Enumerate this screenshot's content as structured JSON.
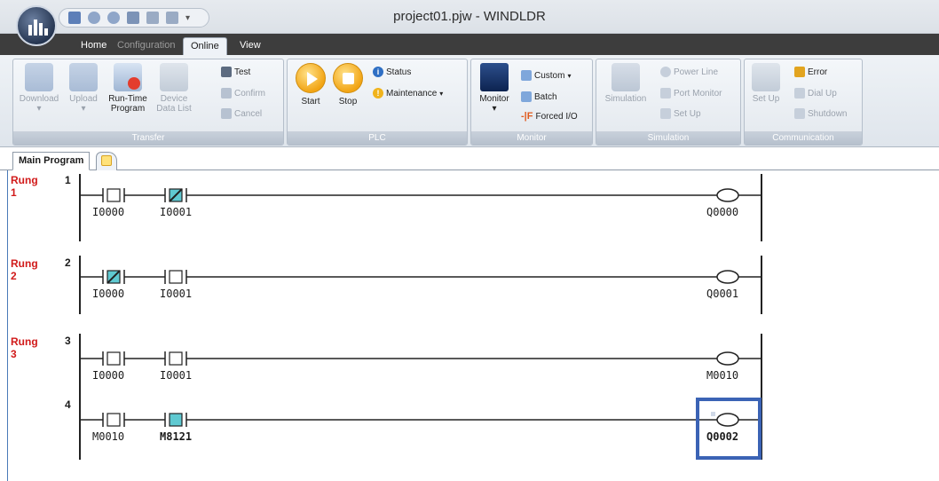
{
  "window": {
    "title": "project01.pjw - WINDLDR"
  },
  "ribbon_tabs": [
    {
      "label": "Home",
      "state": "normal"
    },
    {
      "label": "Configuration",
      "state": "disabled"
    },
    {
      "label": "Online",
      "state": "active"
    },
    {
      "label": "View",
      "state": "normal"
    }
  ],
  "groups": {
    "transfer": {
      "label": "Transfer",
      "download": "Download",
      "upload": "Upload",
      "runtime_1": "Run-Time",
      "runtime_2": "Program",
      "device_1": "Device",
      "device_2": "Data List",
      "test": "Test",
      "confirm": "Confirm",
      "cancel": "Cancel"
    },
    "plc": {
      "label": "PLC",
      "start": "Start",
      "stop": "Stop",
      "status": "Status",
      "maintenance": "Maintenance"
    },
    "monitor": {
      "label": "Monitor",
      "monitor": "Monitor",
      "custom": "Custom",
      "batch": "Batch",
      "forced": "Forced I/O"
    },
    "simulation": {
      "label": "Simulation",
      "simulation": "Simulation",
      "power_line": "Power Line",
      "port_monitor": "Port Monitor",
      "set_up": "Set Up"
    },
    "communication": {
      "label": "Communication",
      "set_up": "Set Up",
      "error": "Error",
      "dial_up": "Dial Up",
      "shutdown": "Shutdown"
    }
  },
  "document_tab": "Main Program",
  "rungs": [
    {
      "label": "Rung",
      "number": "1",
      "index": "1"
    },
    {
      "label": "Rung",
      "number": "2",
      "index": "2"
    },
    {
      "label": "Rung",
      "number": "3",
      "index": "3"
    }
  ],
  "lines": [
    {
      "number": "1",
      "contact_a": "I0000",
      "contact_b": "I0001",
      "coil": "Q0000"
    },
    {
      "number": "2",
      "contact_a": "I0000",
      "contact_b": "I0001",
      "coil": "Q0001"
    },
    {
      "number": "3",
      "contact_a": "I0000",
      "contact_b": "I0001",
      "coil": "M0010"
    },
    {
      "number": "4",
      "contact_a": "M0010",
      "contact_b": "M8121",
      "coil": "Q0002"
    }
  ],
  "colors": {
    "rung_label": "#d11a1a",
    "active_contact_fill": "#5fc9d1",
    "selection_border": "#3b63b5"
  }
}
